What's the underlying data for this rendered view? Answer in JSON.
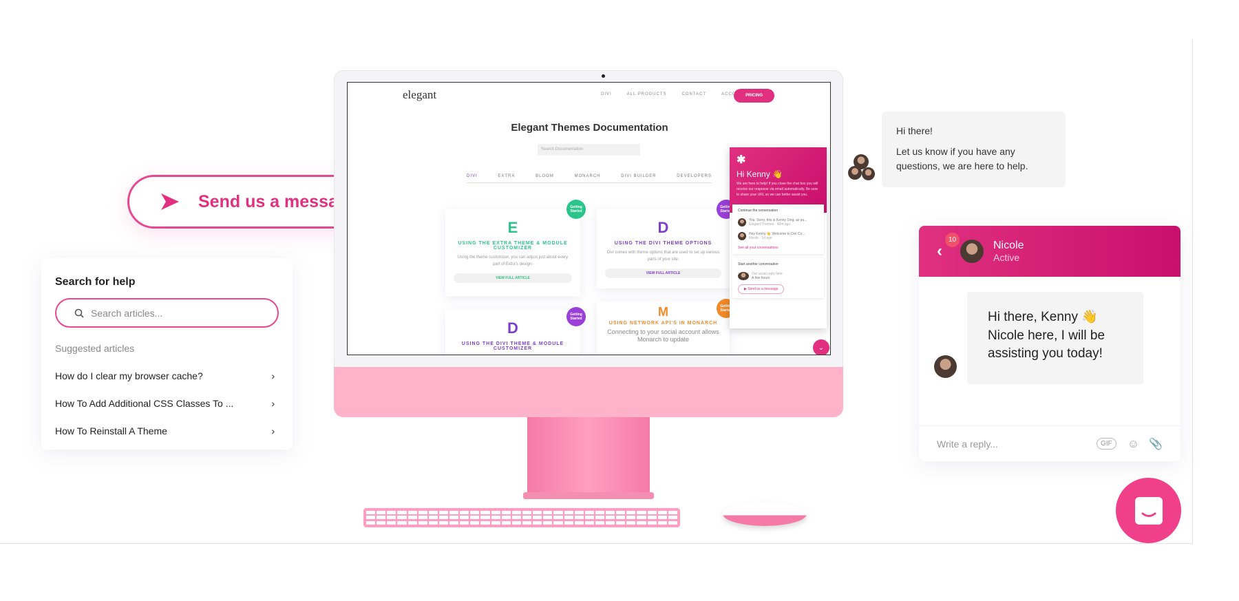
{
  "colors": {
    "accent": "#e0307f",
    "chin": "#ffb3cb"
  },
  "send_pill": {
    "label": "Send us a message",
    "icon": "send-icon"
  },
  "search_card": {
    "title": "Search for help",
    "placeholder": "Search articles...",
    "suggested_label": "Suggested articles",
    "articles": [
      "How do I clear my browser cache?",
      "How To Add Additional CSS Classes To ...",
      "How To Reinstall A Theme"
    ]
  },
  "screen": {
    "logo": "elegant",
    "nav": [
      "DIVI",
      "ALL PRODUCTS",
      "CONTACT",
      "ACCOUNT"
    ],
    "pricing": "PRICING",
    "title": "Elegant Themes Documentation",
    "search_placeholder": "Search Documentation",
    "categories": [
      "DIVI",
      "EXTRA",
      "BLOOM",
      "MONARCH",
      "DIVI BUILDER",
      "DEVELOPERS"
    ],
    "cards": [
      {
        "icon": "E",
        "title": "USING THE EXTRA THEME & MODULE CUSTOMIZER",
        "desc": "Using the theme customizer, you can adjust just about every part of Extra's design.",
        "button": "VIEW FULL ARTICLE",
        "badge": "Getting Started",
        "color": "#2bc48a"
      },
      {
        "icon": "D",
        "title": "USING THE DIVI THEME OPTIONS",
        "desc": "Divi comes with theme options that are used to set up various parts of your site.",
        "button": "VIEW FULL ARTICLE",
        "badge": "Getting Started",
        "color": "#7b3fc8"
      },
      {
        "icon": "D",
        "title": "USING THE DIVI THEME & MODULE CUSTOMIZER",
        "badge": "Getting Started",
        "color": "#7b3fc8"
      },
      {
        "icon": "M",
        "title": "USING NETWORK API'S IN MONARCH",
        "desc": "Connecting to your social account allows Monarch to update",
        "badge": "Getting Started",
        "color": "#f08a2a"
      }
    ],
    "chat": {
      "greeting": "Hi Kenny 👋",
      "intro": "We are here to help! If you close the chat box you will receive our response via email automatically. Be sure to share your URL so we can better assist you.",
      "continue_title": "Continue the conversation",
      "conversations": [
        {
          "text": "You: Sorry, this is Kenny Sing, as pu...",
          "meta": "Elegant Themes · 40m ago"
        },
        {
          "text": "Hey Kenny 👋 Welcome to Divi Co...",
          "meta": "Nicole · 1d ago"
        }
      ],
      "see_all": "See all your conversations",
      "start_title": "Start another conversation",
      "reply_time_label": "Our usual reply time",
      "reply_time": "A few hours",
      "send_button": "Send us a message"
    }
  },
  "hi_bubble": {
    "line1": "Hi there!",
    "line2": "Let us know if you have any questions, we are here to help."
  },
  "nicole_chat": {
    "unread": "10",
    "name": "Nicole",
    "status": "Active",
    "message_line1": "Hi there, Kenny 👋",
    "message_line2": "Nicole here, I will be assisting you today!",
    "reply_placeholder": "Write a reply...",
    "gif": "GIF"
  }
}
